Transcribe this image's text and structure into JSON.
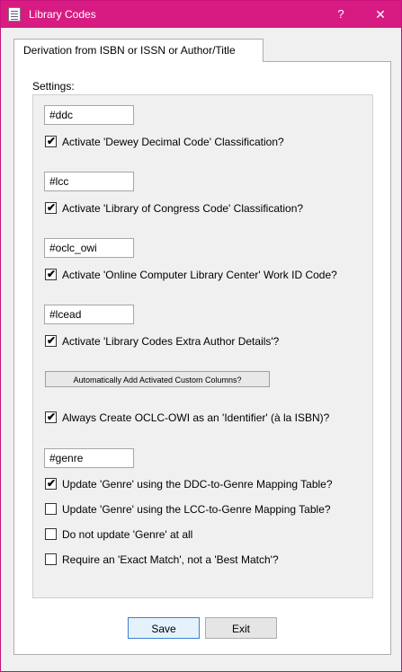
{
  "window": {
    "title": "Library Codes",
    "help_glyph": "?",
    "close_glyph": "✕",
    "title_bar_color": "#d81b83",
    "app_icon": "library-codes-app-icon"
  },
  "tab": {
    "label": "Derivation from ISBN or ISSN or Author/Title"
  },
  "settings": {
    "group_label": "Settings:",
    "ddc_column": "#ddc",
    "activate_ddc": {
      "label": "Activate 'Dewey Decimal Code' Classification?",
      "checked": true
    },
    "lcc_column": "#lcc",
    "activate_lcc": {
      "label": "Activate 'Library of Congress Code' Classification?",
      "checked": true
    },
    "oclc_column": "#oclc_owi",
    "activate_oclc": {
      "label": "Activate 'Online Computer Library Center' Work ID Code?",
      "checked": true
    },
    "lcead_column": "#lcead",
    "activate_lcead": {
      "label": "Activate 'Library Codes Extra Author Details'?",
      "checked": true
    },
    "add_columns_button": "Automatically Add Activated Custom Columns?",
    "create_identifier": {
      "label": "Always Create OCLC-OWI as an 'Identifier' (à la ISBN)?",
      "checked": true
    },
    "genre_column": "#genre",
    "update_genre_ddc": {
      "label": "Update 'Genre' using the DDC-to-Genre Mapping Table?",
      "checked": true
    },
    "update_genre_lcc": {
      "label": "Update 'Genre' using the LCC-to-Genre Mapping Table?",
      "checked": false
    },
    "no_update_genre": {
      "label": "Do not update 'Genre' at all",
      "checked": false
    },
    "exact_match": {
      "label": "Require an 'Exact Match', not a 'Best Match'?",
      "checked": false
    }
  },
  "buttons": {
    "save": "Save",
    "exit": "Exit"
  },
  "checkmark_glyph": "✔"
}
